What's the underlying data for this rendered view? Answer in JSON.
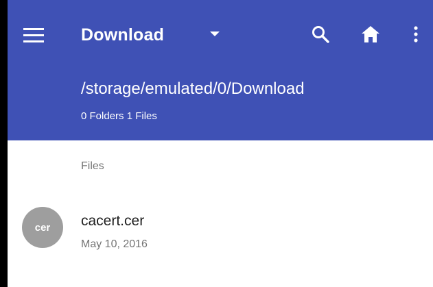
{
  "toolbar": {
    "title": "Download",
    "icons": {
      "menu": "hamburger-menu-icon",
      "dropdown": "dropdown-arrow-icon",
      "search": "search-icon",
      "home": "home-icon",
      "more": "more-vertical-icon"
    }
  },
  "header": {
    "path": "/storage/emulated/0/Download",
    "counts": "0 Folders 1 Files"
  },
  "list": {
    "section_label": "Files",
    "items": [
      {
        "badge": "cer",
        "name": "cacert.cer",
        "date": "May 10, 2016"
      }
    ]
  },
  "colors": {
    "primary": "#3f51b5",
    "badge": "#9e9e9e",
    "secondary_text": "#757575"
  }
}
